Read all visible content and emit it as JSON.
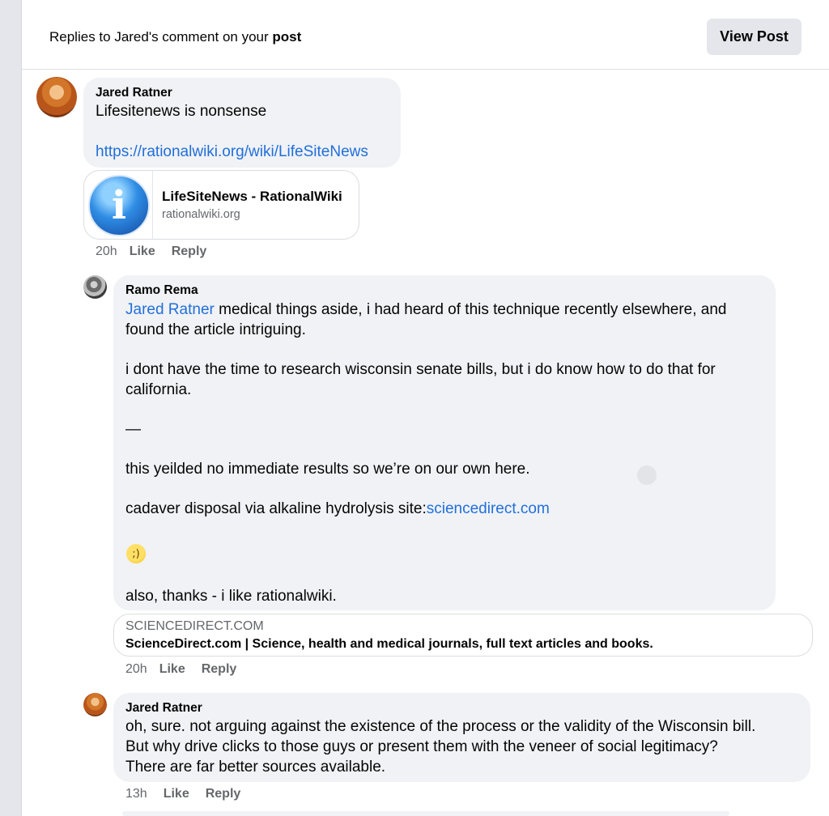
{
  "header": {
    "title_prefix": "Replies to Jared's comment on your ",
    "title_bold": "post",
    "view_post_label": "View Post"
  },
  "comments": [
    {
      "author": "Jared Ratner",
      "text": "Lifesitenews is nonsense",
      "link": "https://rationalwiki.org/wiki/LifeSiteNews",
      "preview": {
        "icon": "info-icon",
        "icon_glyph": "i",
        "title": "LifeSiteNews - RationalWiki",
        "domain": "rationalwiki.org"
      },
      "time": "20h",
      "like": "Like",
      "reply": "Reply"
    },
    {
      "author": "Ramo Rema",
      "mention": "Jared Ratner",
      "line1_rest": " medical things aside, i had heard of this technique recently elsewhere, and",
      "line2": "found the article intriguing.",
      "line3": "i dont have the time to research wisconsin senate bills, but i do know how to do that for",
      "line4": "california.",
      "line5": "—",
      "line6": "this yeilded no immediate results so we’re on our own here.",
      "line7_prefix": "cadaver disposal via alkaline hydrolysis site:",
      "line7_link": "sciencedirect.com",
      "emoji": "winking-face",
      "line8": "also, thanks - i like rationalwiki.",
      "preview": {
        "domain": "SCIENCEDIRECT.COM",
        "title": "ScienceDirect.com | Science, health and medical journals, full text articles and books."
      },
      "time": "20h",
      "like": "Like",
      "reply": "Reply"
    },
    {
      "author": "Jared Ratner",
      "line1": "oh, sure. not arguing against the existence of the process or the validity of the Wisconsin bill.",
      "line2": "But why drive clicks to those guys or present them with the veneer of social legitimacy?",
      "line3": "There are far better sources available.",
      "time": "13h",
      "like": "Like",
      "reply": "Reply"
    }
  ]
}
